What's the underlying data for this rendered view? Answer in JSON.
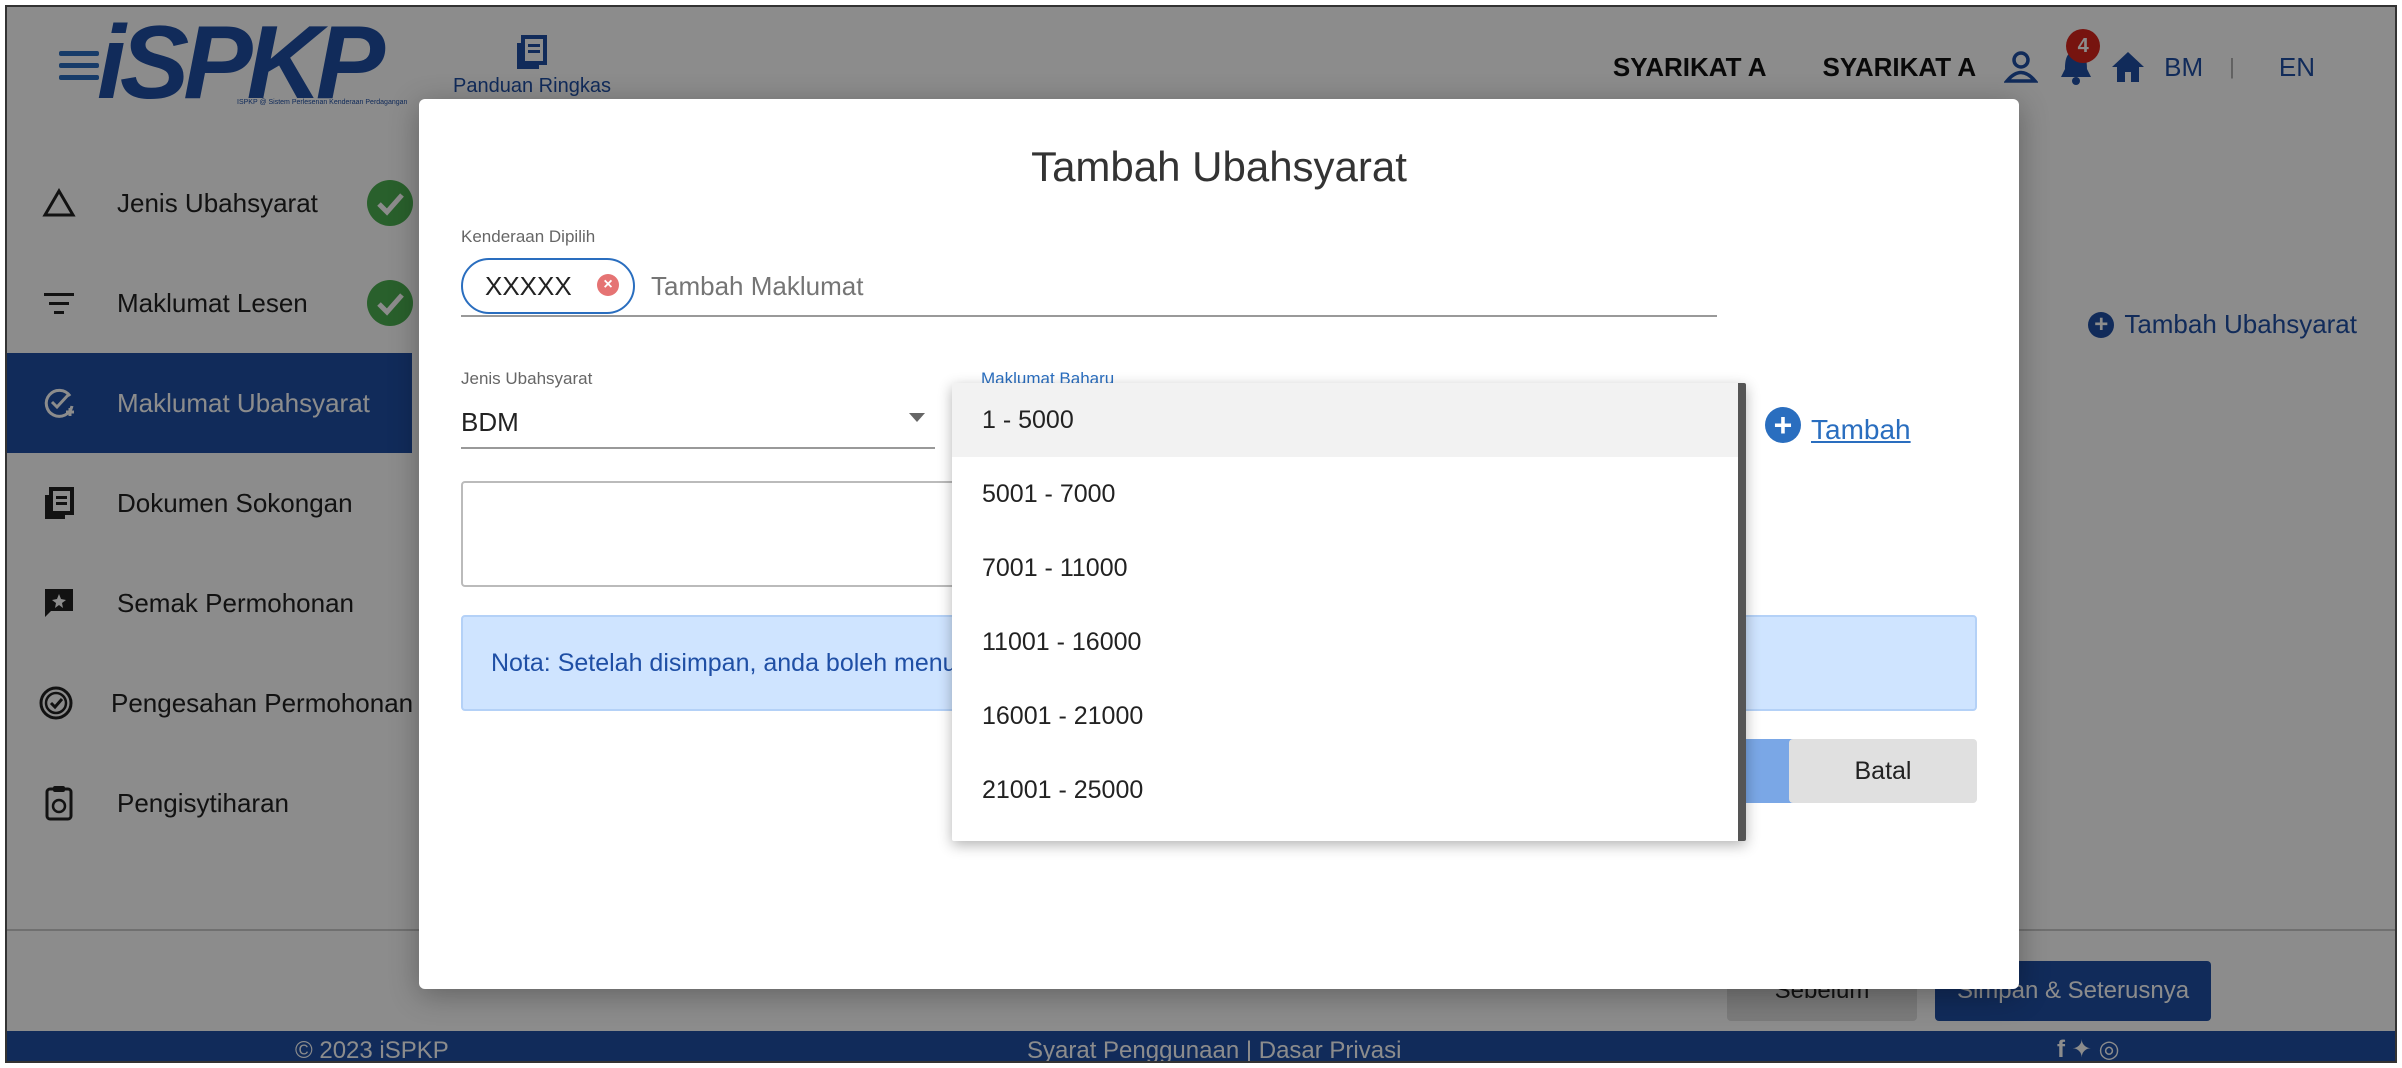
{
  "header": {
    "logo_text": "iSPKP",
    "logo_tagline": "ISPKP @ Sistem Perlesenan Kenderaan Perdagangan",
    "guide_label": "Panduan Ringkas",
    "company_1": "SYARIKAT A",
    "company_2": "SYARIKAT A",
    "notification_count": "4",
    "lang_bm": "BM",
    "lang_sep": "|",
    "lang_en": "EN"
  },
  "sidebar": {
    "items": [
      {
        "label": "Jenis Ubahsyarat",
        "icon": "triangle-icon",
        "done": true
      },
      {
        "label": "Maklumat Lesen",
        "icon": "filter-lines-icon",
        "done": true
      },
      {
        "label": "Maklumat Ubahsyarat",
        "icon": "edit-check-icon",
        "active": true
      },
      {
        "label": "Dokumen Sokongan",
        "icon": "document-stack-icon"
      },
      {
        "label": "Semak Permohonan",
        "icon": "review-chat-icon"
      },
      {
        "label": "Pengesahan Permohonan",
        "icon": "verified-badge-icon"
      },
      {
        "label": "Pengisytiharan",
        "icon": "clipboard-icon"
      }
    ]
  },
  "main": {
    "add_label": "Tambah Ubahsyarat",
    "prev_label": "Sebelum",
    "next_label": "Simpan & Seterusnya"
  },
  "footer": {
    "copyright": "© 2023 iSPKP",
    "links": "Syarat Penggunaan | Dasar Privasi",
    "social": "f ✦ ◎"
  },
  "modal": {
    "title": "Tambah Ubahsyarat",
    "kenderaan_label": "Kenderaan Dipilih",
    "chip_value": "XXXXX",
    "chip_placeholder": "Tambah Maklumat",
    "jenis_label": "Jenis Ubahsyarat",
    "jenis_value": "BDM",
    "baharu_label": "Maklumat Baharu",
    "tambah_label": "Tambah",
    "nota_text": "Nota: Setelah disimpan, anda boleh menu",
    "batal_label": "Batal"
  },
  "dropdown": {
    "options": [
      "1 - 5000",
      "5001 - 7000",
      "7001 - 11000",
      "11001 - 16000",
      "16001 - 21000",
      "21001 - 25000"
    ]
  },
  "colors": {
    "primary": "#1f4fa5",
    "accent": "#2a6ebf",
    "success": "#4caf50",
    "badge": "#d9261c",
    "note_bg": "#cfe4ff"
  }
}
